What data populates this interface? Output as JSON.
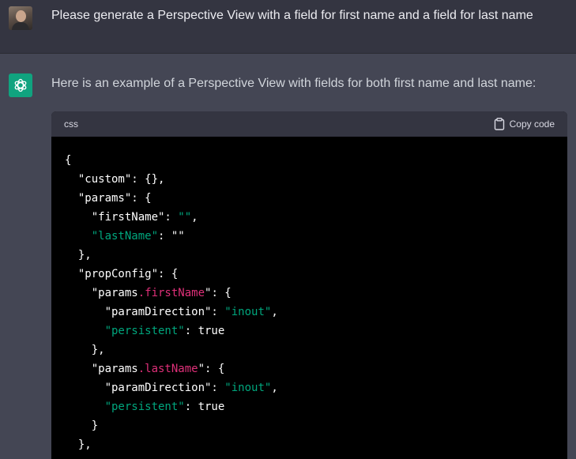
{
  "user_message": {
    "text": "Please generate a Perspective View with a field for first name and a field for last name"
  },
  "assistant_message": {
    "text": "Here is an example of a Perspective View with fields for both first name and last name:"
  },
  "code_block": {
    "language": "css",
    "copy_label": "Copy code",
    "lines": [
      [
        {
          "t": "{",
          "c": "w"
        }
      ],
      [
        {
          "t": "  \"custom\": {},",
          "c": "w"
        }
      ],
      [
        {
          "t": "  \"params\": {",
          "c": "w"
        }
      ],
      [
        {
          "t": "    \"firstName\": ",
          "c": "w"
        },
        {
          "t": "\"\"",
          "c": "s"
        },
        {
          "t": ",",
          "c": "w"
        }
      ],
      [
        {
          "t": "    \"lastName\"",
          "c": "s"
        },
        {
          "t": ": ",
          "c": "w"
        },
        {
          "t": "\"\"",
          "c": "w"
        }
      ],
      [
        {
          "t": "  },",
          "c": "w"
        }
      ],
      [
        {
          "t": "  \"propConfig\": {",
          "c": "w"
        }
      ],
      [
        {
          "t": "    \"params",
          "c": "w"
        },
        {
          "t": ".firstName",
          "c": "p"
        },
        {
          "t": "\": {",
          "c": "w"
        }
      ],
      [
        {
          "t": "      \"paramDirection\": ",
          "c": "w"
        },
        {
          "t": "\"inout\"",
          "c": "s"
        },
        {
          "t": ",",
          "c": "w"
        }
      ],
      [
        {
          "t": "      \"persistent\"",
          "c": "s"
        },
        {
          "t": ": true",
          "c": "w"
        }
      ],
      [
        {
          "t": "    },",
          "c": "w"
        }
      ],
      [
        {
          "t": "    \"params",
          "c": "w"
        },
        {
          "t": ".lastName",
          "c": "p"
        },
        {
          "t": "\": {",
          "c": "w"
        }
      ],
      [
        {
          "t": "      \"paramDirection\": ",
          "c": "w"
        },
        {
          "t": "\"inout\"",
          "c": "s"
        },
        {
          "t": ",",
          "c": "w"
        }
      ],
      [
        {
          "t": "      \"persistent\"",
          "c": "s"
        },
        {
          "t": ": true",
          "c": "w"
        }
      ],
      [
        {
          "t": "    }",
          "c": "w"
        }
      ],
      [
        {
          "t": "  },",
          "c": "w"
        }
      ]
    ]
  },
  "colors": {
    "user_bg": "#343541",
    "assistant_bg": "#444654",
    "brand_green": "#10a37f",
    "code_string": "#00a67d",
    "code_property": "#df3079"
  },
  "icons": {
    "user_avatar": "user-avatar",
    "assistant_avatar": "openai-logo-icon",
    "copy": "clipboard-icon"
  }
}
